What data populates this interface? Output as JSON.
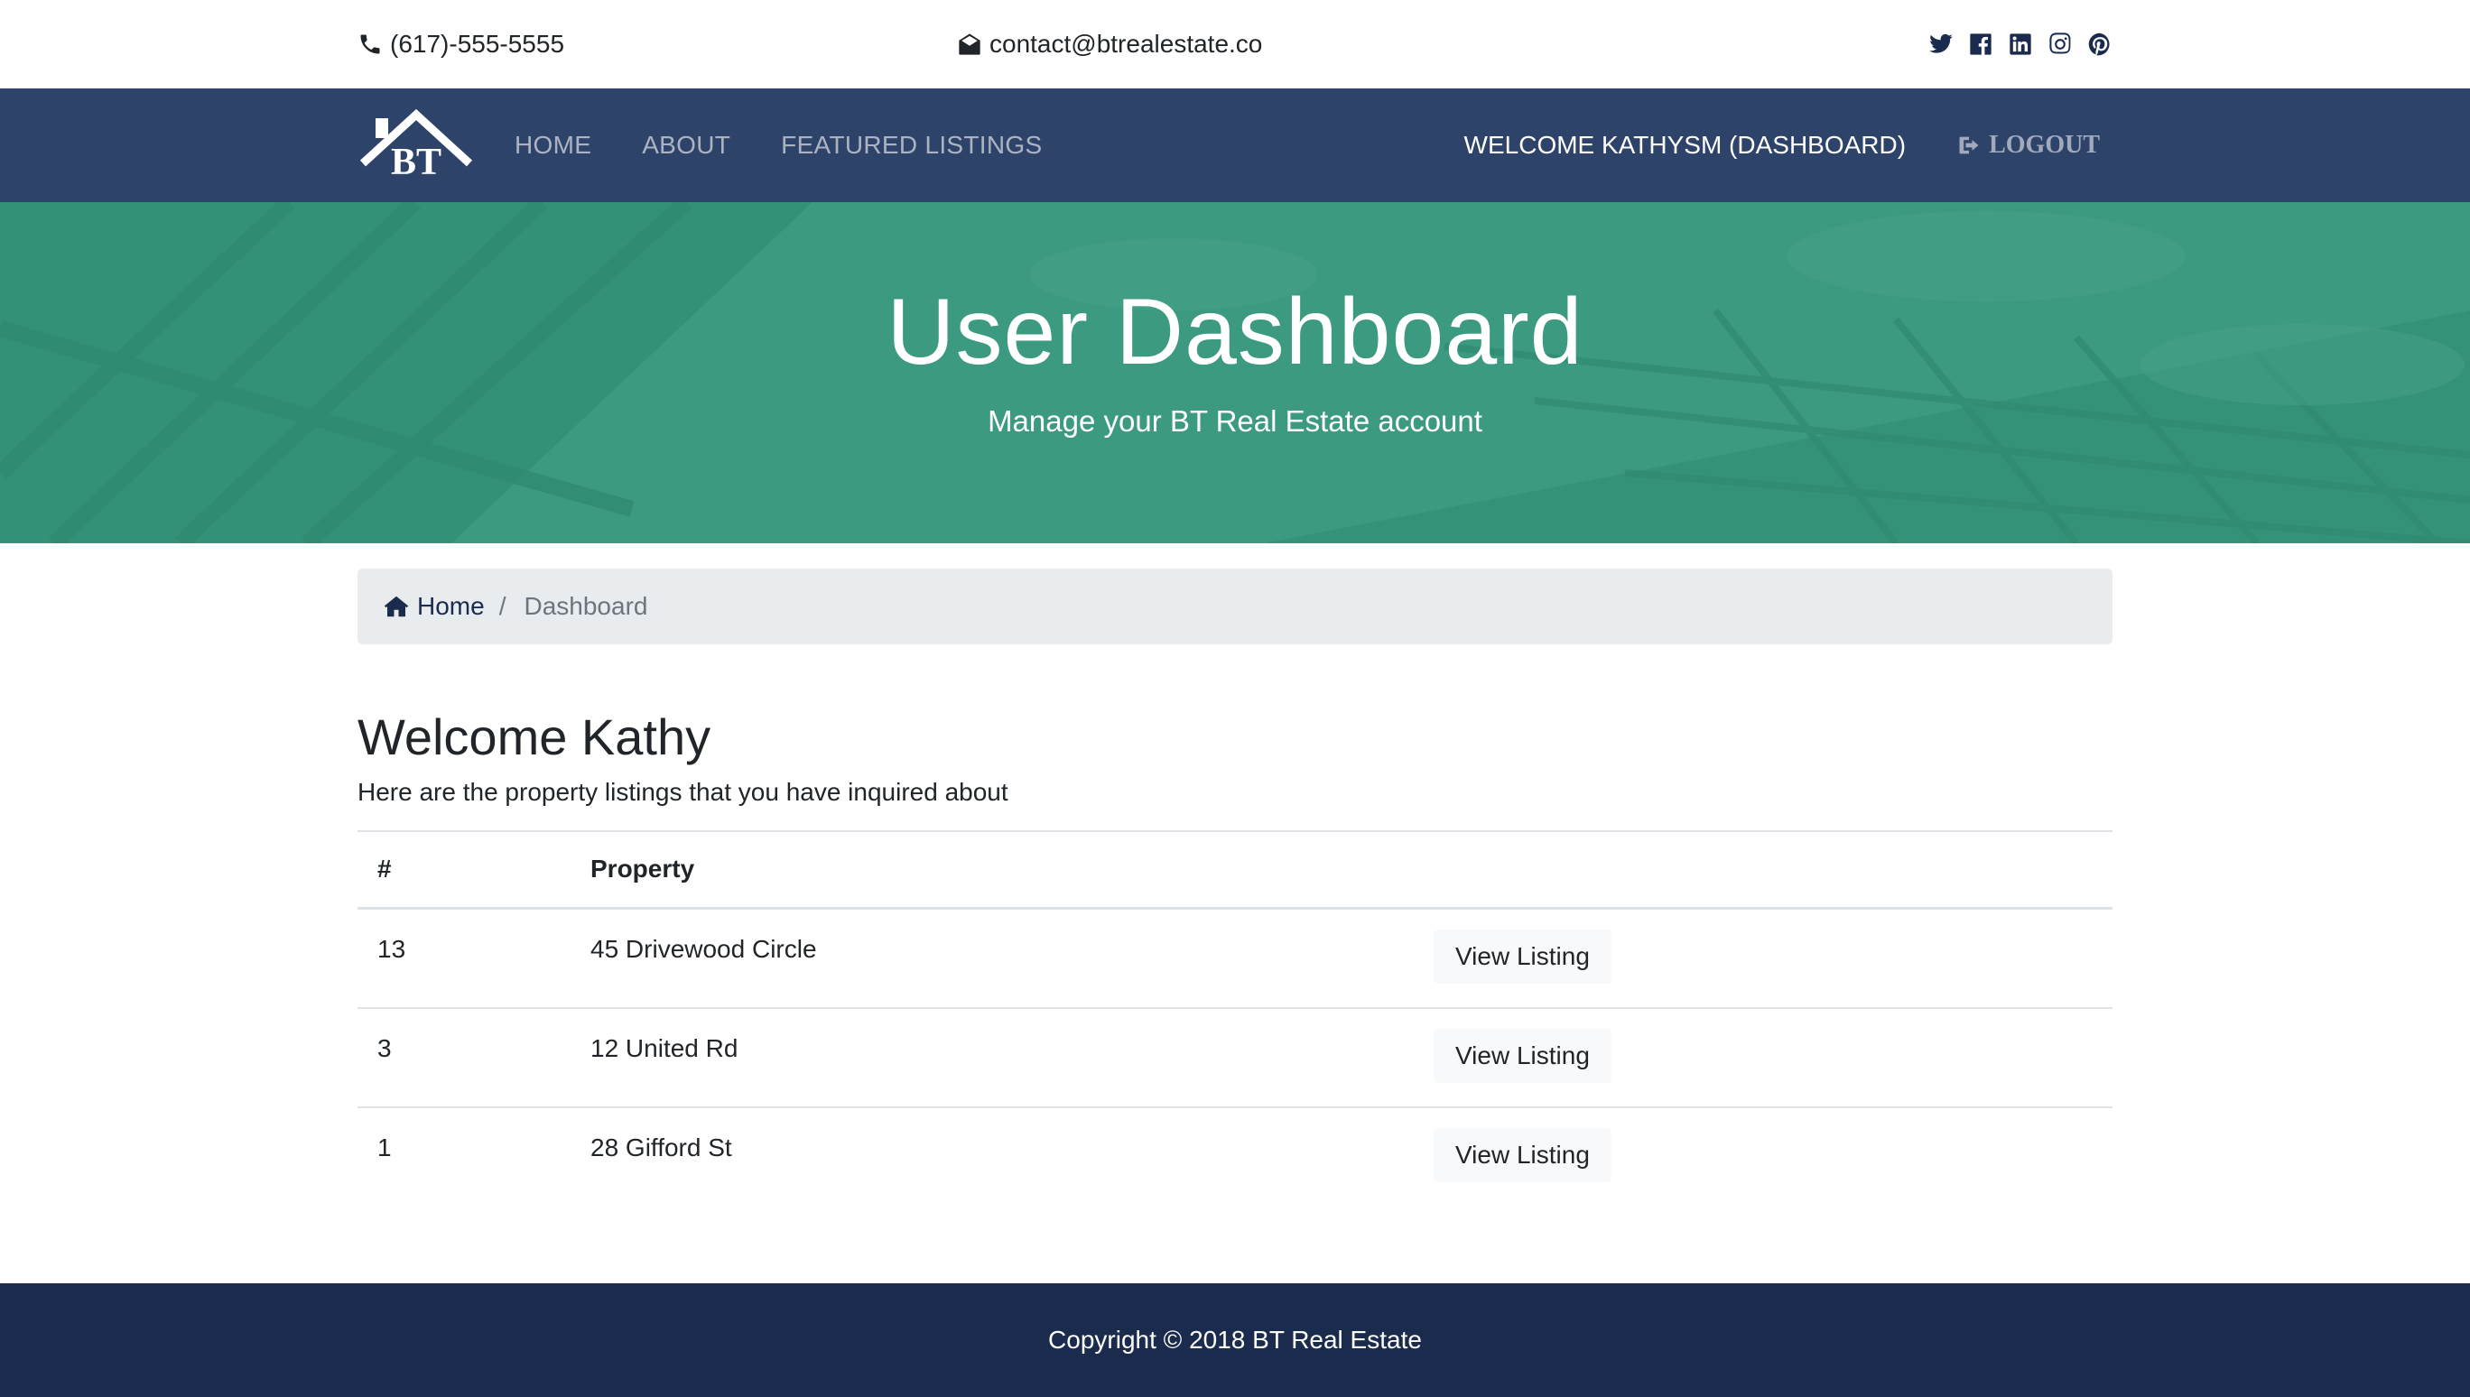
{
  "topbar": {
    "phone": "(617)-555-5555",
    "email": "contact@btrealestate.co",
    "social": [
      "twitter-icon",
      "facebook-icon",
      "linkedin-icon",
      "instagram-icon",
      "pinterest-icon"
    ]
  },
  "navbar": {
    "logo_text": "BT",
    "links": [
      "HOME",
      "ABOUT",
      "FEATURED LISTINGS"
    ],
    "welcome": "WELCOME KATHYSM (DASHBOARD)",
    "logout": "LOGOUT"
  },
  "hero": {
    "title": "User Dashboard",
    "subtitle": "Manage your BT Real Estate account"
  },
  "breadcrumb": {
    "home": "Home",
    "separator": "/",
    "current": "Dashboard"
  },
  "main": {
    "title": "Welcome Kathy",
    "subtitle": "Here are the property listings that you have inquired about",
    "table": {
      "headers": [
        "#",
        "Property",
        ""
      ],
      "rows": [
        {
          "id": "13",
          "property": "45 Drivewood Circle",
          "action": "View Listing"
        },
        {
          "id": "3",
          "property": "12 United Rd",
          "action": "View Listing"
        },
        {
          "id": "1",
          "property": "28 Gifford St",
          "action": "View Listing"
        }
      ]
    }
  },
  "footer": {
    "copyright": "Copyright © 2018 BT Real Estate"
  },
  "colors": {
    "navbar": "#2e4369",
    "footer": "#1b2b4d",
    "hero_overlay": "#3d9a84",
    "breadcrumb_bg": "#e9ecef"
  }
}
